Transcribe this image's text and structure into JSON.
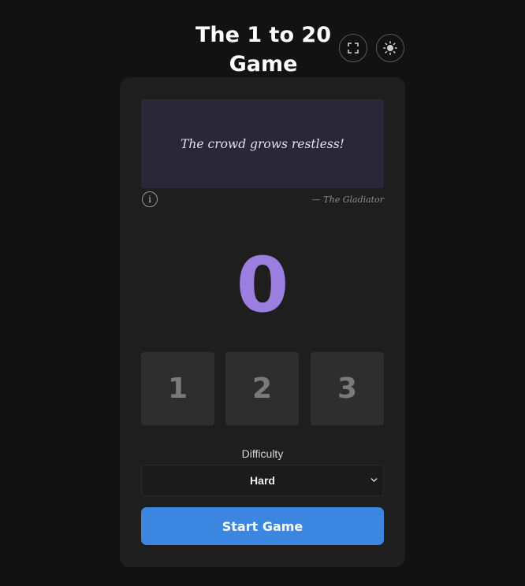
{
  "header": {
    "title": "The 1 to 20 Game",
    "fullscreen_icon": "fullscreen-icon",
    "theme_icon": "sun-icon"
  },
  "quote": {
    "text": "The crowd grows restless!",
    "attribution": "— The Gladiator",
    "info_glyph": "i"
  },
  "game": {
    "count": "0",
    "choices": [
      "1",
      "2",
      "3"
    ]
  },
  "difficulty": {
    "label": "Difficulty",
    "selected": "Hard"
  },
  "actions": {
    "start_label": "Start Game"
  },
  "colors": {
    "background": "#121212",
    "card": "#1e1e1f",
    "quote_bg": "#2a2739",
    "counter": "#9b7fe0",
    "start_button": "#3a86e0"
  }
}
